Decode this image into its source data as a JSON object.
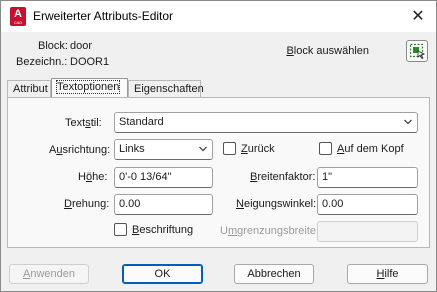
{
  "window": {
    "title": "Erweiterter Attributs-Editor",
    "app_icon_letter": "A",
    "app_icon_sub": "CAD",
    "close_glyph": "✕"
  },
  "info": {
    "block_label": "Block:",
    "block_value": "door",
    "tag_label": "Bezeichn.:",
    "tag_value": "DOOR1",
    "block_select_label": "Block auswählen"
  },
  "tabs": [
    {
      "label": "Attribut",
      "active": false
    },
    {
      "label": "Textoptionen",
      "active": true
    },
    {
      "label": "Eigenschaften",
      "active": false
    }
  ],
  "form": {
    "textstyle_label": "Textstil:",
    "textstyle_value": "Standard",
    "justification_label": "Ausrichtung:",
    "justification_value": "Links",
    "backwards_label": "Zurück",
    "backwards_checked": false,
    "upsidedown_label": "Auf dem Kopf",
    "upsidedown_checked": false,
    "height_label": "Höhe:",
    "height_value": "0'-0 13/64\"",
    "width_factor_label": "Breitenfaktor:",
    "width_factor_value": "1\"",
    "rotation_label": "Drehung:",
    "rotation_value": "0.00",
    "oblique_label": "Neigungswinkel:",
    "oblique_value": "0.00",
    "annotative_label": "Beschriftung",
    "annotative_checked": false,
    "boundary_width_label": "Umgrenzungsbreite:",
    "boundary_width_value": ""
  },
  "buttons": {
    "apply": "Anwenden",
    "ok": "OK",
    "cancel": "Abbrechen",
    "help": "Hilfe"
  },
  "colors": {
    "accent": "#005fb8",
    "app_icon": "#c8102e"
  }
}
